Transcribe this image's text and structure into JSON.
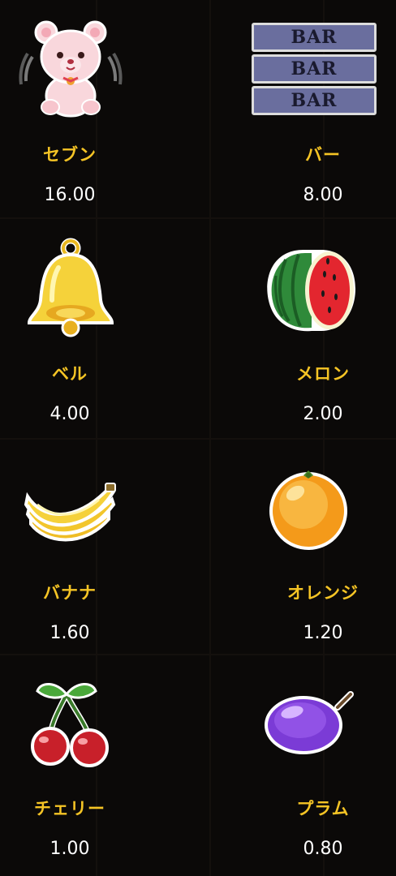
{
  "paytable": {
    "items": [
      {
        "name": "セブン",
        "payout": "16.00",
        "icon": "teddy-bear-icon"
      },
      {
        "name": "バー",
        "payout": "8.00",
        "icon": "triple-bar-icon"
      },
      {
        "name": "ベル",
        "payout": "4.00",
        "icon": "bell-icon"
      },
      {
        "name": "メロン",
        "payout": "2.00",
        "icon": "watermelon-icon"
      },
      {
        "name": "バナナ",
        "payout": "1.60",
        "icon": "banana-icon"
      },
      {
        "name": "オレンジ",
        "payout": "1.20",
        "icon": "orange-icon"
      },
      {
        "name": "チェリー",
        "payout": "1.00",
        "icon": "cherry-icon"
      },
      {
        "name": "プラム",
        "payout": "0.80",
        "icon": "plum-icon"
      }
    ],
    "bar_label": "BAR"
  },
  "colors": {
    "background": "#0b0908",
    "name_text": "#f5c425",
    "value_text": "#ffffff"
  }
}
